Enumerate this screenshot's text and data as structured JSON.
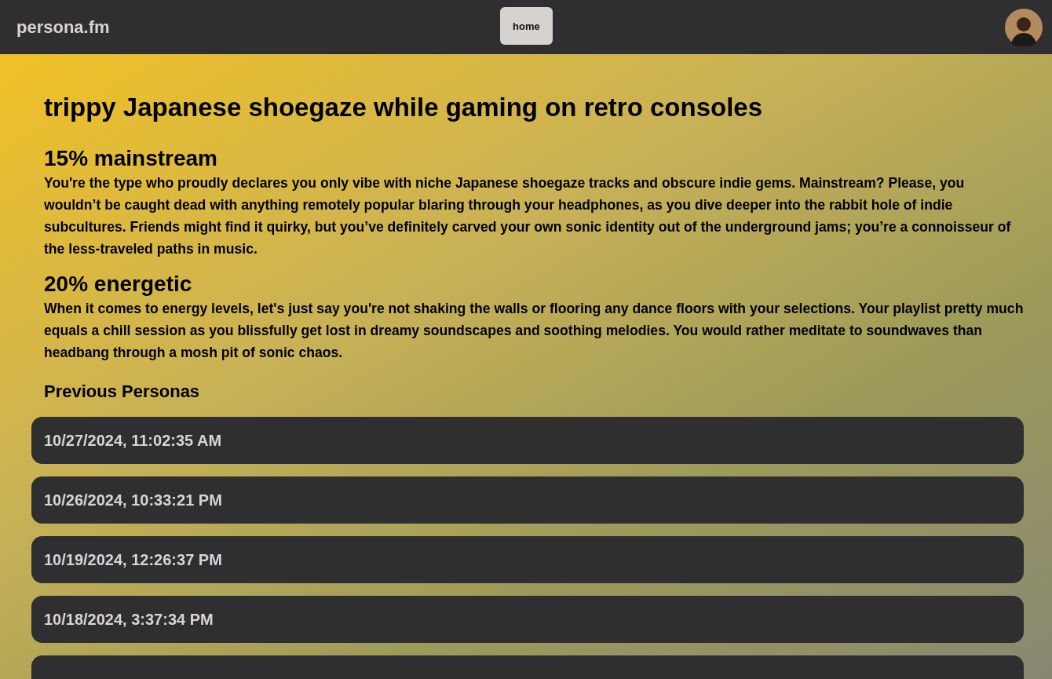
{
  "header": {
    "logo": "persona.fm",
    "nav": [
      {
        "label": "home",
        "selected": true
      }
    ]
  },
  "persona": {
    "title": "trippy Japanese shoegaze while gaming on retro consoles",
    "traits": [
      {
        "heading": "15% mainstream",
        "text": "You're the type who proudly declares you only vibe with niche Japanese shoegaze tracks and obscure indie gems. Mainstream? Please, you wouldn’t be caught dead with anything remotely popular blaring through your headphones, as you dive deeper into the rabbit hole of indie subcultures. Friends might find it quirky, but you’ve definitely carved your own sonic identity out of the underground jams; you’re a connoisseur of the less-traveled paths in music."
      },
      {
        "heading": "20% energetic",
        "text": "When it comes to energy levels, let's just say you're not shaking the walls or flooring any dance floors with your selections. Your playlist pretty much equals a chill session as you blissfully get lost in dreamy soundscapes and soothing melodies. You would rather meditate to soundwaves than headbang through a mosh pit of sonic chaos."
      }
    ]
  },
  "previous": {
    "heading": "Previous Personas",
    "items": [
      {
        "label": "10/27/2024, 11:02:35 AM"
      },
      {
        "label": "10/26/2024, 10:33:21 PM"
      },
      {
        "label": "10/19/2024, 12:26:37 PM"
      },
      {
        "label": "10/18/2024, 3:37:34 PM"
      }
    ]
  }
}
